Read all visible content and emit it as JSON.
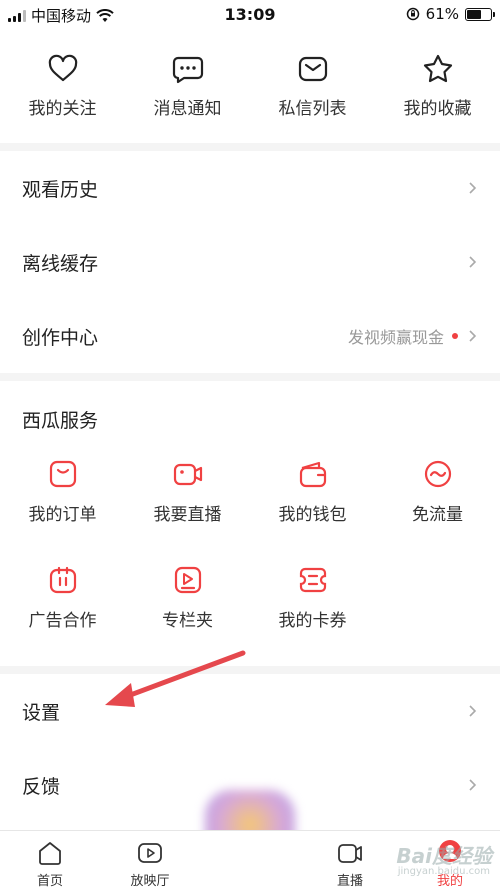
{
  "status": {
    "carrier": "中国移动",
    "time": "13:09",
    "battery": "61%",
    "battery_level": 0.61
  },
  "quick": [
    {
      "label": "我的关注",
      "icon": "heart-icon"
    },
    {
      "label": "消息通知",
      "icon": "chat-bubble-icon"
    },
    {
      "label": "私信列表",
      "icon": "envelope-icon"
    },
    {
      "label": "我的收藏",
      "icon": "star-icon"
    }
  ],
  "rows": {
    "history": "观看历史",
    "offline": "离线缓存",
    "creator": "创作中心",
    "creator_hint": "发视频赢现金",
    "settings": "设置",
    "feedback": "反馈"
  },
  "services": {
    "title": "西瓜服务",
    "items": [
      {
        "label": "我的订单",
        "icon": "order-bag-icon"
      },
      {
        "label": "我要直播",
        "icon": "live-camera-icon"
      },
      {
        "label": "我的钱包",
        "icon": "wallet-icon"
      },
      {
        "label": "免流量",
        "icon": "free-data-icon"
      },
      {
        "label": "广告合作",
        "icon": "ad-cooperation-icon"
      },
      {
        "label": "专栏夹",
        "icon": "column-folder-icon"
      },
      {
        "label": "我的卡券",
        "icon": "coupon-icon"
      }
    ]
  },
  "tabs": [
    {
      "label": "首页",
      "icon": "home-icon"
    },
    {
      "label": "放映厅",
      "icon": "play-screen-icon"
    },
    {
      "label": "直播",
      "icon": "live-tab-camera-icon"
    },
    {
      "label": "我的",
      "icon": "profile-icon"
    }
  ],
  "watermark": {
    "text": "Bai度经验",
    "sub": "jingyan.baidu.com"
  },
  "colors": {
    "accent": "#f04142",
    "annotation_arrow": "#e5484d"
  }
}
